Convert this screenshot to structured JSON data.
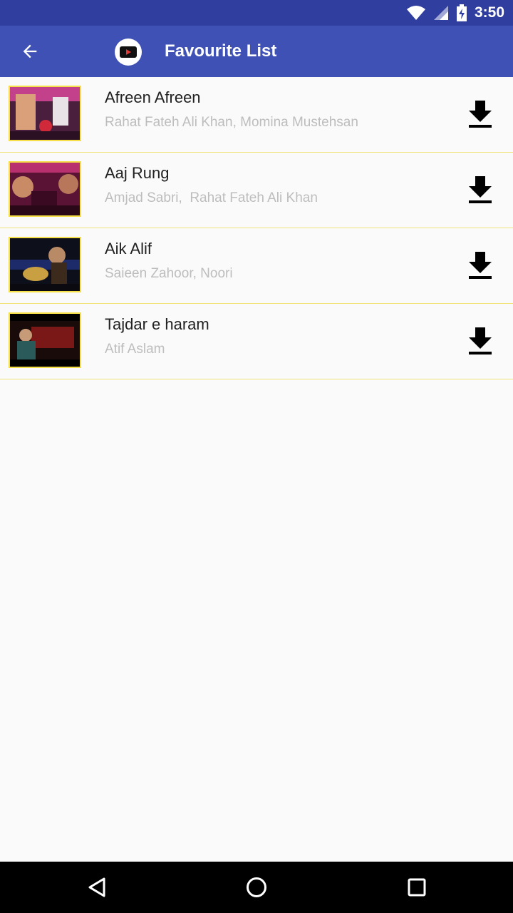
{
  "status_bar": {
    "time": "3:50",
    "icons": [
      "wifi-icon",
      "cell-signal-icon",
      "battery-charging-icon"
    ]
  },
  "app_bar": {
    "title": "Favourite List",
    "back_icon": "arrow-back-icon",
    "logo_icon": "play-logo-icon"
  },
  "colors": {
    "status_bar": "#303f9f",
    "app_bar": "#3f51b5",
    "thumb_border": "#f5e04a",
    "row_divider": "#f1e27a",
    "subtitle_text": "#bdbdbd"
  },
  "favourites": [
    {
      "title": "Afreen Afreen",
      "artists": "Rahat Fateh Ali Khan, Momina Mustehsan",
      "action_icon": "download-icon"
    },
    {
      "title": "Aaj Rung",
      "artists": "Amjad Sabri,  Rahat Fateh Ali Khan",
      "action_icon": "download-icon"
    },
    {
      "title": "Aik Alif",
      "artists": "Saieen Zahoor, Noori",
      "action_icon": "download-icon"
    },
    {
      "title": "Tajdar e haram",
      "artists": "Atif Aslam",
      "action_icon": "download-icon"
    }
  ],
  "nav_bar": {
    "buttons": [
      "back-triangle-icon",
      "home-circle-icon",
      "recents-square-icon"
    ]
  }
}
